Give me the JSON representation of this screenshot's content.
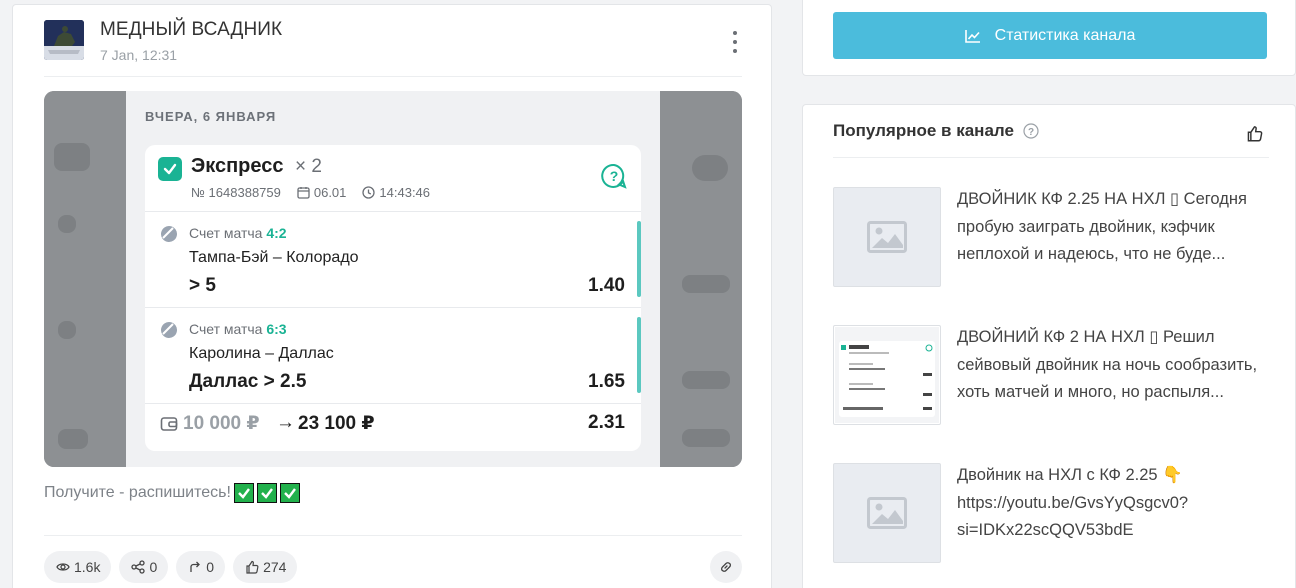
{
  "post": {
    "channel_name": "МЕДНЫЙ ВСАДНИК",
    "time": "7 Jan, 12:31",
    "avatar_icon": "bronze-horseman-avatar",
    "more_icon": "kebab-menu-icon",
    "text": "Получите - распишитесь!",
    "emoji": [
      "✅",
      "✅",
      "✅"
    ],
    "stats": {
      "views": "1.6k",
      "shares": "0",
      "forwards": "0",
      "likes": "274"
    }
  },
  "bet_slip": {
    "date_header": "ВЧЕРА, 6 ЯНВАРЯ",
    "title": "Экспресс",
    "multiplier": "× 2",
    "number": "№ 1648388759",
    "date": "06.01",
    "time": "14:43:46",
    "legs": [
      {
        "market": "Счет матча",
        "score": "4:2",
        "teams": "Тампа-Бэй – Колорадо",
        "pick": "> 5",
        "odd": "1.40"
      },
      {
        "market": "Счет матча",
        "score": "6:3",
        "teams": "Каролина – Даллас",
        "pick": "Даллас > 2.5",
        "odd": "1.65"
      }
    ],
    "stake": "10 000 ₽",
    "arrow": "→",
    "payout": "23 100 ₽",
    "total_odd": "2.31",
    "accent_color": "#1ab394"
  },
  "sidebar": {
    "stats_button": "Статистика канала",
    "stats_color": "#4bbcdc",
    "popular_title": "Популярное в канале",
    "popular_items": [
      {
        "text": "ДВОЙНИК КФ 2.25 НА НХЛ ▯ Сегодня пробую заиграть двойник, кэфчик неплохой и надеюсь, что не буде...",
        "thumb": "placeholder-image-icon"
      },
      {
        "text": "ДВОЙНИЙ КФ 2 НА НХЛ ▯ Решил сейвовый двойник на ночь сообразить, хоть матчей и много, но распыля...",
        "thumb": "bet-slip-thumbnail"
      },
      {
        "text": "Двойник на НХЛ с КФ 2.25 👇 https://youtu.be/GvsYyQsgcv0?si=IDKx22scQQV53bdE",
        "thumb": "placeholder-image-icon"
      }
    ]
  }
}
